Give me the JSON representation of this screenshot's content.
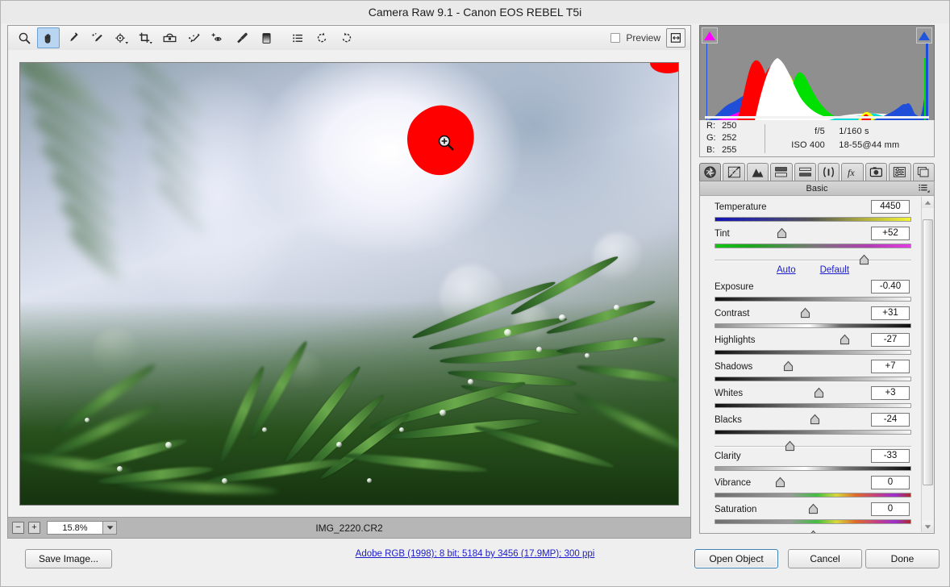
{
  "window": {
    "title": "Camera Raw 9.1  -  Canon EOS REBEL T5i"
  },
  "toolbar": {
    "tools": [
      {
        "name": "zoom-tool",
        "label": "Zoom Tool",
        "selected": false
      },
      {
        "name": "hand-tool",
        "label": "Hand Tool",
        "selected": true
      },
      {
        "name": "white-balance-tool",
        "label": "White Balance Tool",
        "selected": false
      },
      {
        "name": "color-sampler-tool",
        "label": "Color Sampler Tool",
        "selected": false
      },
      {
        "name": "targeted-adjustment-tool",
        "label": "Targeted Adjustment Tool",
        "selected": false
      },
      {
        "name": "crop-tool",
        "label": "Crop Tool",
        "selected": false
      },
      {
        "name": "straighten-tool",
        "label": "Straighten Tool",
        "selected": false
      },
      {
        "name": "spot-removal-tool",
        "label": "Spot Removal",
        "selected": false
      },
      {
        "name": "red-eye-removal-tool",
        "label": "Red Eye Removal",
        "selected": false
      },
      {
        "name": "adjustment-brush-tool",
        "label": "Adjustment Brush",
        "selected": false
      },
      {
        "name": "graduated-filter-tool",
        "label": "Graduated Filter",
        "selected": false
      },
      {
        "name": "presets-tool",
        "label": "Presets",
        "selected": false
      },
      {
        "name": "rotate-counterclockwise-tool",
        "label": "Rotate Image Counterclockwise",
        "selected": false
      },
      {
        "name": "rotate-clockwise-tool",
        "label": "Rotate Image Clockwise",
        "selected": false
      }
    ],
    "preview_label": "Preview",
    "preview_checked": false,
    "fullscreen_label": "Toggle Full Screen Mode"
  },
  "image": {
    "filename": "IMG_2220.CR2",
    "zoom_level": "15.8%",
    "zoom_out_label": "−",
    "zoom_in_label": "+",
    "clipping_overlay_color": "#fe0000",
    "cursor": "zoom-in-cursor"
  },
  "histogram": {
    "shadow_clipping_color": "#ff00ff",
    "highlight_clipping_color": "#1f4fd8",
    "background_color": "#8f8f8f"
  },
  "readout": {
    "r_key": "R:",
    "r_value": "250",
    "g_key": "G:",
    "g_value": "252",
    "b_key": "B:",
    "b_value": "255",
    "aperture": "f/5",
    "shutter": "1/160 s",
    "iso": "ISO 400",
    "lens": "18-55@44 mm"
  },
  "panel": {
    "tabs": [
      {
        "name": "tab-basic",
        "label": "Basic",
        "active": true
      },
      {
        "name": "tab-tone-curve",
        "label": "Tone Curve",
        "active": false
      },
      {
        "name": "tab-detail",
        "label": "Detail",
        "active": false
      },
      {
        "name": "tab-hsl-grayscale",
        "label": "HSL / Grayscale",
        "active": false
      },
      {
        "name": "tab-split-toning",
        "label": "Split Toning",
        "active": false
      },
      {
        "name": "tab-lens-corrections",
        "label": "Lens Corrections",
        "active": false
      },
      {
        "name": "tab-effects",
        "label": "Effects",
        "active": false
      },
      {
        "name": "tab-camera-calibration",
        "label": "Camera Calibration",
        "active": false
      },
      {
        "name": "tab-presets",
        "label": "Presets",
        "active": false
      },
      {
        "name": "tab-snapshots",
        "label": "Snapshots",
        "active": false
      }
    ],
    "header_title": "Basic",
    "auto_label": "Auto",
    "default_label": "Default",
    "sliders": [
      {
        "name": "temperature",
        "label": "Temperature",
        "value": "4450",
        "pos": 34,
        "track": "t-temp"
      },
      {
        "name": "tint",
        "label": "Tint",
        "value": "+52",
        "pos": 76,
        "track": "t-tint"
      },
      {
        "name": "exposure",
        "label": "Exposure",
        "value": "-0.40",
        "pos": 46,
        "track": "t-gray"
      },
      {
        "name": "contrast",
        "label": "Contrast",
        "value": "+31",
        "pos": 66,
        "track": "t-contrast"
      },
      {
        "name": "highlights",
        "label": "Highlights",
        "value": "-27",
        "pos": 37,
        "track": "t-gray"
      },
      {
        "name": "shadows",
        "label": "Shadows",
        "value": "+7",
        "pos": 53,
        "track": "t-gray"
      },
      {
        "name": "whites",
        "label": "Whites",
        "value": "+3",
        "pos": 51,
        "track": "t-gray"
      },
      {
        "name": "blacks",
        "label": "Blacks",
        "value": "-24",
        "pos": 38,
        "track": "t-gray"
      },
      {
        "name": "clarity",
        "label": "Clarity",
        "value": "-33",
        "pos": 33,
        "track": "t-clarity"
      },
      {
        "name": "vibrance",
        "label": "Vibrance",
        "value": "0",
        "pos": 50,
        "track": "t-vib"
      },
      {
        "name": "saturation",
        "label": "Saturation",
        "value": "0",
        "pos": 50,
        "track": "t-vib"
      }
    ]
  },
  "footer": {
    "save_image_label": "Save Image...",
    "workflow_link": "Adobe RGB (1998); 8 bit; 5184 by 3456 (17.9MP); 300 ppi",
    "open_object_label": "Open Object",
    "cancel_label": "Cancel",
    "done_label": "Done"
  }
}
